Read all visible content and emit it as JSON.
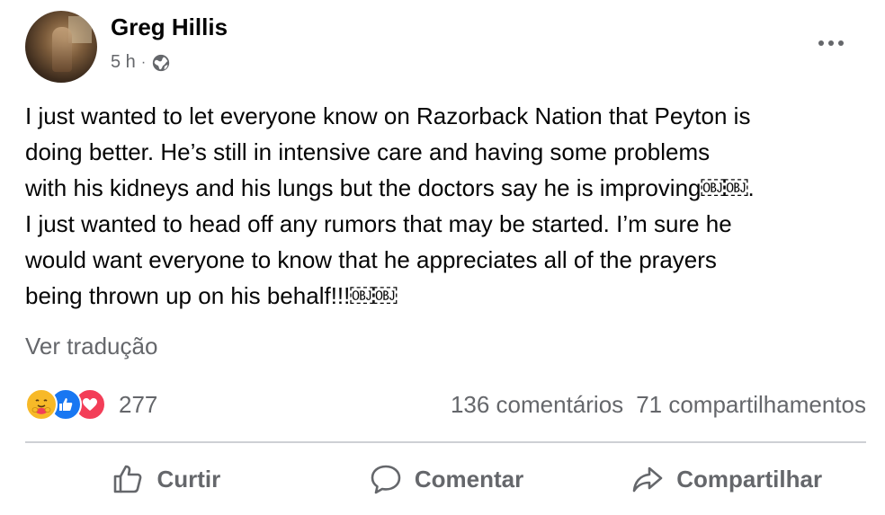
{
  "post": {
    "author": "Greg Hillis",
    "time": "5 h",
    "separator": "·",
    "visibility_icon": "globe-icon",
    "more_icon": "more-options-icon",
    "text_lines": [
      "I just wanted to let everyone know on Razorback Nation that Peyton is",
      "doing better. He’s still in intensive care and having some problems",
      "with his kidneys and his lungs but the doctors say he is improving￼￼.",
      "I just wanted to head off any rumors that may be started. I’m sure he",
      "would want everyone to know that he appreciates all of the prayers",
      "being thrown up on his behalf!!!￼￼"
    ],
    "see_translation": "Ver tradução"
  },
  "stats": {
    "reactions": [
      "care-reaction-icon",
      "like-reaction-icon",
      "love-reaction-icon"
    ],
    "reaction_count": "277",
    "comments": "136 comentários",
    "shares": "71 compartilhamentos"
  },
  "actions": {
    "like": {
      "label": "Curtir",
      "icon": "thumbs-up-icon"
    },
    "comment": {
      "label": "Comentar",
      "icon": "comment-bubble-icon"
    },
    "share": {
      "label": "Compartilhar",
      "icon": "share-arrow-icon"
    }
  },
  "colors": {
    "text": "#050505",
    "secondary": "#65676b",
    "divider": "#ced0d4",
    "like_blue": "#1877f2",
    "love_red": "#f33e58",
    "care_yellow": "#f7b928"
  }
}
